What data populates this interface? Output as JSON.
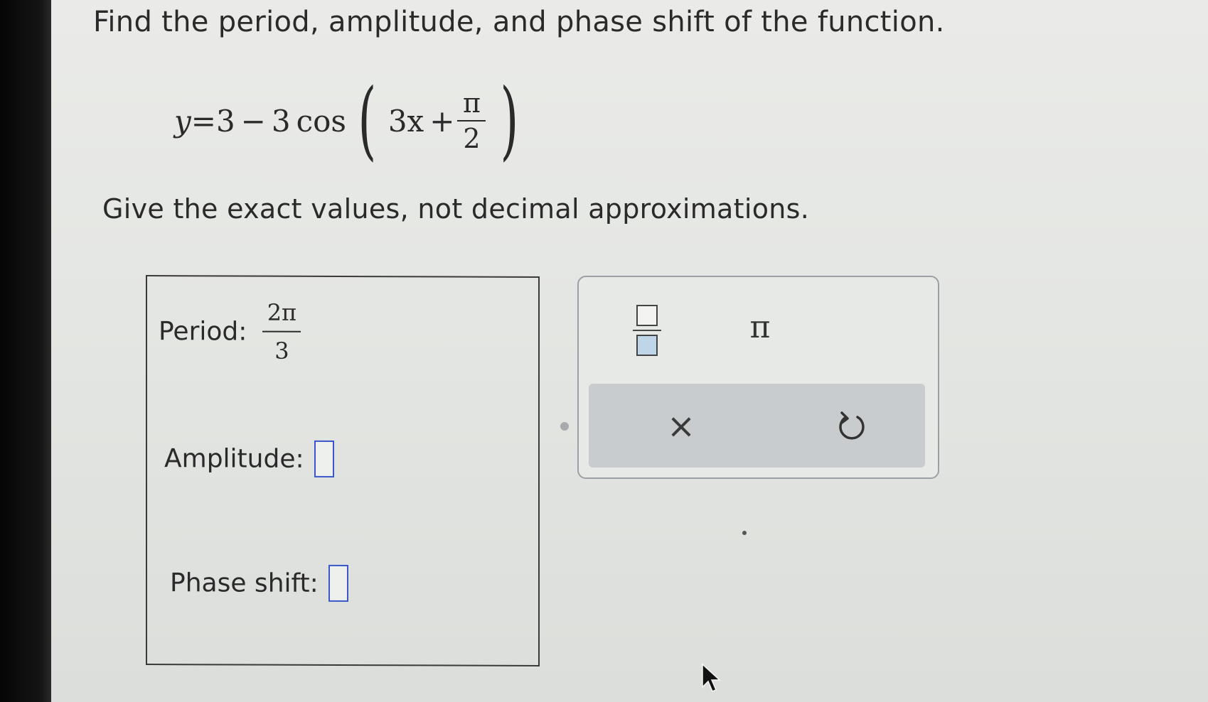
{
  "question": "Find the period, amplitude, and phase shift of the function.",
  "equation": {
    "lhs": "y",
    "equals": "=",
    "constant": "3",
    "minus": "−",
    "coef": "3",
    "func": "cos",
    "inner": "3x",
    "plus": "+",
    "frac_num": "π",
    "frac_den": "2"
  },
  "instructions": "Give the exact values, not decimal approximations.",
  "answers": {
    "period_label": "Period:",
    "period_num": "2π",
    "period_den": "3",
    "amplitude_label": "Amplitude:",
    "phase_label": "Phase shift:"
  },
  "palette": {
    "pi_symbol": "π",
    "clear_symbol": "×"
  },
  "colors": {
    "input_border": "#3b57c9",
    "fraction_highlight": "#bfd6e8",
    "action_bar": "#c9ccce"
  },
  "icons": {
    "fraction": "fraction-template-icon",
    "clear": "close-icon",
    "undo": "undo-icon",
    "cursor": "mouse-pointer-icon"
  }
}
